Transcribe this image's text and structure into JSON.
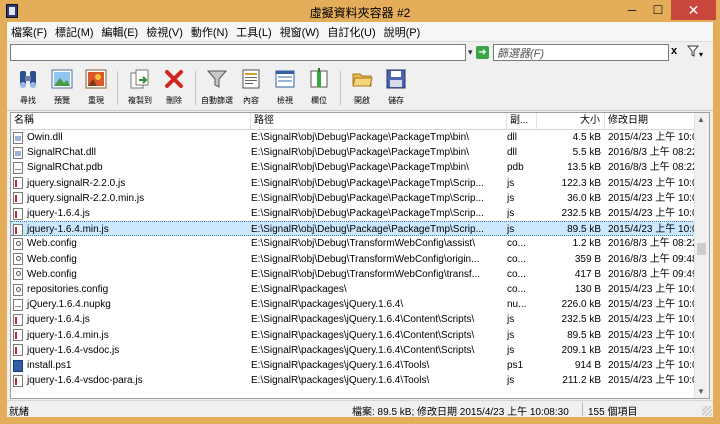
{
  "window": {
    "title": "虛擬資料夾容器 #2",
    "minimize": "─",
    "maximize": "☐",
    "close": "✕"
  },
  "menu": [
    "檔案(F)",
    "標記(M)",
    "編輯(E)",
    "檢視(V)",
    "動作(N)",
    "工具(L)",
    "視窗(W)",
    "自訂化(U)",
    "說明(P)"
  ],
  "address": {
    "path_value": "",
    "filter_placeholder": "篩選器(F)",
    "clear_label": "x",
    "dropdown_glyph": "▾"
  },
  "toolbar": [
    {
      "label": "尋找",
      "icon": "binoculars-icon"
    },
    {
      "label": "預覽",
      "icon": "picture-icon"
    },
    {
      "label": "重現",
      "icon": "image-refresh-icon"
    },
    {
      "label": "複製到",
      "icon": "copy-to-icon"
    },
    {
      "label": "刪除",
      "icon": "delete-icon"
    },
    {
      "label": "自動篩選",
      "icon": "funnel-icon"
    },
    {
      "label": "內容",
      "icon": "properties-icon"
    },
    {
      "label": "檢視",
      "icon": "view-icon"
    },
    {
      "label": "欄位",
      "icon": "columns-icon"
    },
    {
      "label": "開啟",
      "icon": "open-folder-icon"
    },
    {
      "label": "儲存",
      "icon": "save-icon"
    }
  ],
  "columns": [
    "名稱",
    "路徑",
    "副...",
    "大小",
    "修改日期"
  ],
  "sort_indicator": "^",
  "files": [
    {
      "name": "Owin.dll",
      "icon": "dll",
      "path": "E:\\SignalR\\obj\\Debug\\Package\\PackageTmp\\bin\\",
      "type": "dll",
      "size": "4.5 kB",
      "date": "2015/4/23 上午 10:0"
    },
    {
      "name": "SignalRChat.dll",
      "icon": "dll",
      "path": "E:\\SignalR\\obj\\Debug\\Package\\PackageTmp\\bin\\",
      "type": "dll",
      "size": "5.5 kB",
      "date": "2016/8/3 上午 08:22"
    },
    {
      "name": "SignalRChat.pdb",
      "icon": "pkg",
      "path": "E:\\SignalR\\obj\\Debug\\Package\\PackageTmp\\bin\\",
      "type": "pdb",
      "size": "13.5 kB",
      "date": "2016/8/3 上午 08:22"
    },
    {
      "name": "jquery.signalR-2.2.0.js",
      "icon": "js",
      "path": "E:\\SignalR\\obj\\Debug\\Package\\PackageTmp\\Scrip...",
      "type": "js",
      "size": "122.3 kB",
      "date": "2015/4/23 上午 10:0"
    },
    {
      "name": "jquery.signalR-2.2.0.min.js",
      "icon": "js",
      "path": "E:\\SignalR\\obj\\Debug\\Package\\PackageTmp\\Scrip...",
      "type": "js",
      "size": "36.0 kB",
      "date": "2015/4/23 上午 10:0"
    },
    {
      "name": "jquery-1.6.4.js",
      "icon": "js",
      "path": "E:\\SignalR\\obj\\Debug\\Package\\PackageTmp\\Scrip...",
      "type": "js",
      "size": "232.5 kB",
      "date": "2015/4/23 上午 10:0"
    },
    {
      "name": "jquery-1.6.4.min.js",
      "icon": "js",
      "path": "E:\\SignalR\\obj\\Debug\\Package\\PackageTmp\\Scrip...",
      "type": "js",
      "size": "89.5 kB",
      "date": "2015/4/23 上午 10:0",
      "selected": true
    },
    {
      "name": "Web.config",
      "icon": "cfg",
      "path": "E:\\SignalR\\obj\\Debug\\TransformWebConfig\\assist\\",
      "type": "co...",
      "size": "1.2 kB",
      "date": "2016/8/3 上午 08:22"
    },
    {
      "name": "Web.config",
      "icon": "cfg",
      "path": "E:\\SignalR\\obj\\Debug\\TransformWebConfig\\origin...",
      "type": "co...",
      "size": "359 B",
      "date": "2016/8/3 上午 09:48"
    },
    {
      "name": "Web.config",
      "icon": "cfg",
      "path": "E:\\SignalR\\obj\\Debug\\TransformWebConfig\\transf...",
      "type": "co...",
      "size": "417 B",
      "date": "2016/8/3 上午 09:49"
    },
    {
      "name": "repositories.config",
      "icon": "cfg",
      "path": "E:\\SignalR\\packages\\",
      "type": "co...",
      "size": "130 B",
      "date": "2015/4/23 上午 10:0"
    },
    {
      "name": "jQuery.1.6.4.nupkg",
      "icon": "pkg",
      "path": "E:\\SignalR\\packages\\jQuery.1.6.4\\",
      "type": "nu...",
      "size": "226.0 kB",
      "date": "2015/4/23 上午 10:0"
    },
    {
      "name": "jquery-1.6.4.js",
      "icon": "js",
      "path": "E:\\SignalR\\packages\\jQuery.1.6.4\\Content\\Scripts\\",
      "type": "js",
      "size": "232.5 kB",
      "date": "2015/4/23 上午 10:0"
    },
    {
      "name": "jquery-1.6.4.min.js",
      "icon": "js",
      "path": "E:\\SignalR\\packages\\jQuery.1.6.4\\Content\\Scripts\\",
      "type": "js",
      "size": "89.5 kB",
      "date": "2015/4/23 上午 10:0"
    },
    {
      "name": "jquery-1.6.4-vsdoc.js",
      "icon": "js",
      "path": "E:\\SignalR\\packages\\jQuery.1.6.4\\Content\\Scripts\\",
      "type": "js",
      "size": "209.1 kB",
      "date": "2015/4/23 上午 10:0"
    },
    {
      "name": "install.ps1",
      "icon": "ps1",
      "path": "E:\\SignalR\\packages\\jQuery.1.6.4\\Tools\\",
      "type": "ps1",
      "size": "914 B",
      "date": "2015/4/23 上午 10:0"
    },
    {
      "name": "jquery-1.6.4-vsdoc-para.js",
      "icon": "js",
      "path": "E:\\SignalR\\packages\\jQuery.1.6.4\\Tools\\",
      "type": "js",
      "size": "211.2 kB",
      "date": "2015/4/23 上午 10:0"
    }
  ],
  "scrollbar": {
    "up": "▲",
    "down": "▼"
  },
  "status": {
    "left": "就緒",
    "info": "檔案: 89.5 kB; 修改日期 2015/4/23 上午 10:08:30",
    "count": "155 個項目"
  }
}
